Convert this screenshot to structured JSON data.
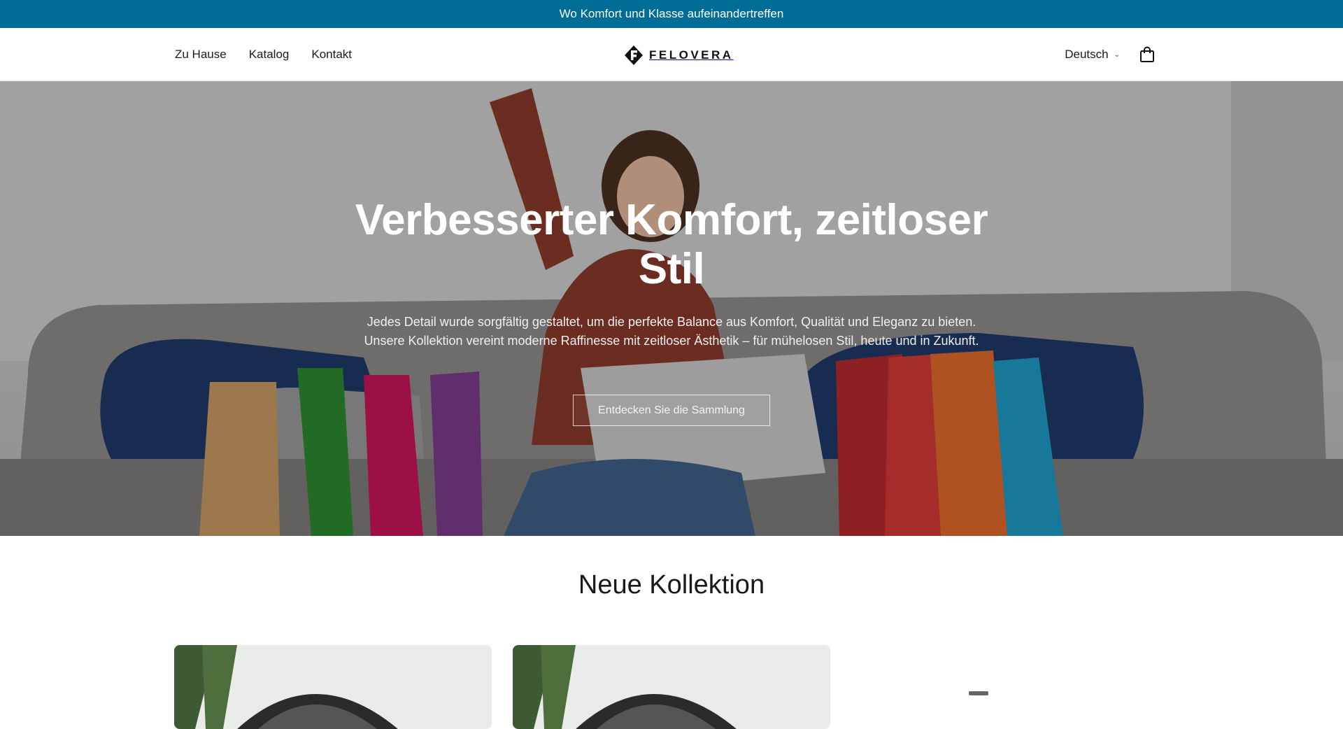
{
  "announcement": {
    "text": "Wo Komfort und Klasse aufeinandertreffen"
  },
  "header": {
    "nav": [
      {
        "label": "Zu Hause"
      },
      {
        "label": "Katalog"
      },
      {
        "label": "Kontakt"
      }
    ],
    "logo": {
      "text": "FELOVERA",
      "icon": "felovera-logo-icon"
    },
    "language": {
      "selected": "Deutsch",
      "icon": "chevron-down-icon"
    },
    "cart": {
      "icon": "shopping-bag-icon"
    }
  },
  "hero": {
    "title": "Verbesserter Komfort, zeitloser Stil",
    "text": "Jedes Detail wurde sorgfältig gestaltet, um die perfekte Balance aus Komfort, Qualität und Eleganz zu bieten. Unsere Kollektion vereint moderne Raffinesse mit zeitloser Ästhetik – für mühelosen Stil, heute und in Zukunft.",
    "button_label": "Entdecken Sie die Sammlung"
  },
  "collection": {
    "title": "Neue Kollektion"
  },
  "colors": {
    "announcement_bg": "#006d97",
    "text": "#1a1a1a",
    "white": "#ffffff"
  }
}
